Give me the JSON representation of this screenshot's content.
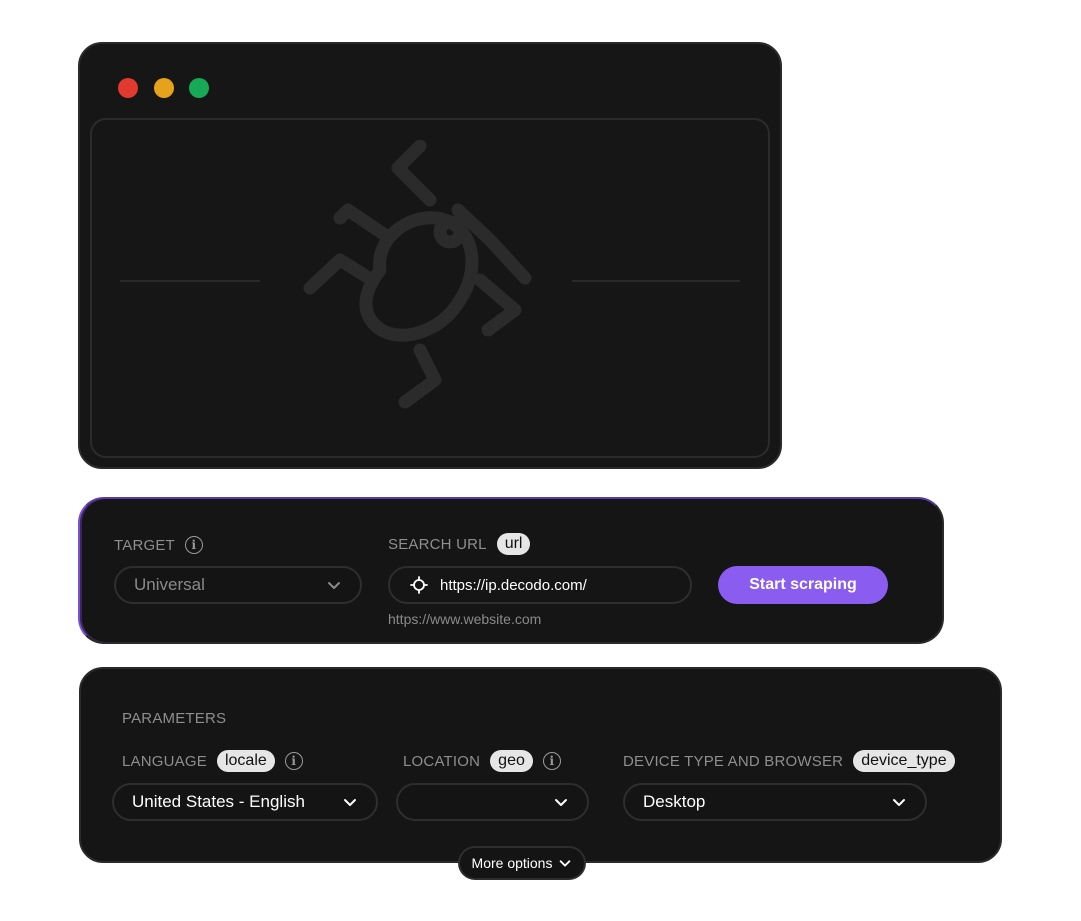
{
  "browser": {
    "window_controls": [
      "close",
      "minimize",
      "maximize"
    ],
    "illustration_icon": "bug-icon"
  },
  "scraper": {
    "target": {
      "label": "TARGET",
      "value": "Universal"
    },
    "search_url": {
      "label": "SEARCH URL",
      "tag": "url",
      "value": "https://ip.decodo.com/",
      "hint": "https://www.website.com"
    },
    "start_button": "Start scraping"
  },
  "parameters": {
    "title": "PARAMETERS",
    "language": {
      "label": "LANGUAGE",
      "tag": "locale",
      "value": "United States - English"
    },
    "location": {
      "label": "LOCATION",
      "tag": "geo",
      "value": ""
    },
    "device": {
      "label": "DEVICE TYPE AND BROWSER",
      "tag": "device_type",
      "value": "Desktop"
    },
    "more_options": "More options"
  },
  "colors": {
    "accent": "#8a5cf0",
    "panel_bg": "#151515",
    "close": "#e23a2f",
    "minimize": "#e7a21b",
    "maximize": "#17a955"
  }
}
